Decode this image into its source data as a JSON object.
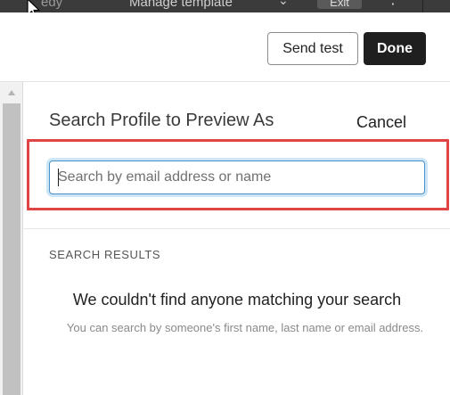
{
  "topbar": {
    "breadcrumb": "edy",
    "template_menu": "Manage template",
    "exit_label": "Exit",
    "more_label": "⋮"
  },
  "header": {
    "send_test_label": "Send test",
    "done_label": "Done"
  },
  "panel": {
    "title": "Search Profile to Preview As",
    "cancel_label": "Cancel",
    "search": {
      "placeholder": "Search by email address or name",
      "value": ""
    },
    "results_heading": "SEARCH RESULTS",
    "empty_title": "We couldn't find anyone matching your search",
    "empty_subtitle": "You can search by someone's first name, last name or email address."
  },
  "colors": {
    "highlight": "#e04444",
    "done_bg": "#1f1f1f",
    "focus_ring": "#4a90c4"
  }
}
